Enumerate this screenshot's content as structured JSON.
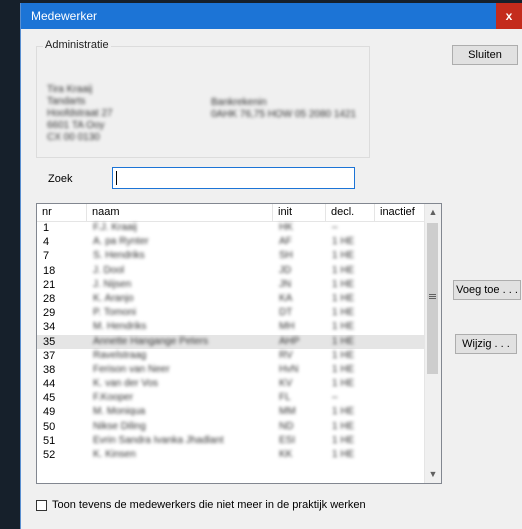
{
  "window": {
    "title": "Medewerker",
    "close_glyph": "x"
  },
  "admin": {
    "label": "Administratie",
    "left_lines": [
      "Tira Kraaij",
      "Tandarts",
      "Hoofdstraat 27",
      "6601 TA Ooy",
      "CX 00 0130"
    ],
    "right_lines": [
      "Bankrekenin",
      "0AHK 76,75 HOW 05 2080 1421"
    ]
  },
  "buttons": {
    "sluiten": "Sluiten",
    "voeg_toe": "Voeg toe . . .",
    "wijzig": "Wijzig . . ."
  },
  "search": {
    "label": "Zoek",
    "value": ""
  },
  "table": {
    "headers": {
      "nr": "nr",
      "naam": "naam",
      "init": "init",
      "decl": "decl.",
      "inactief": "inactief"
    },
    "rows": [
      {
        "nr": "1",
        "naam": "F.J. Kraaij",
        "init": "HK",
        "decl": "–",
        "selected": false
      },
      {
        "nr": "4",
        "naam": "A. pa Rynter",
        "init": "AF",
        "decl": "1 HE",
        "selected": false
      },
      {
        "nr": "7",
        "naam": "S. Hendriks",
        "init": "SH",
        "decl": "1 HE",
        "selected": false
      },
      {
        "nr": "18",
        "naam": "J. Dool",
        "init": "JD",
        "decl": "1 HE",
        "selected": false
      },
      {
        "nr": "21",
        "naam": "J. Nijsen",
        "init": "JN",
        "decl": "1 HE",
        "selected": false
      },
      {
        "nr": "28",
        "naam": "K. Aranjo",
        "init": "KA",
        "decl": "1 HE",
        "selected": false
      },
      {
        "nr": "29",
        "naam": "P. Tomoni",
        "init": "DT",
        "decl": "1 HE",
        "selected": false
      },
      {
        "nr": "34",
        "naam": "M. Hendriks",
        "init": "MH",
        "decl": "1 HE",
        "selected": false
      },
      {
        "nr": "35",
        "naam": "Annette Hangange Peters",
        "init": "AHP",
        "decl": "1 HE",
        "selected": true
      },
      {
        "nr": "37",
        "naam": "Ravelstraag",
        "init": "RV",
        "decl": "1 HE",
        "selected": false
      },
      {
        "nr": "38",
        "naam": "Ferison van Neer",
        "init": "HvN",
        "decl": "1 HE",
        "selected": false
      },
      {
        "nr": "44",
        "naam": "K. van der Vos",
        "init": "KV",
        "decl": "1 HE",
        "selected": false
      },
      {
        "nr": "45",
        "naam": "F.Kooper",
        "init": "FL",
        "decl": "–",
        "selected": false
      },
      {
        "nr": "49",
        "naam": "M. Moniqua",
        "init": "MM",
        "decl": "1 HE",
        "selected": false
      },
      {
        "nr": "50",
        "naam": "Nikse Diling",
        "init": "ND",
        "decl": "1 HE",
        "selected": false
      },
      {
        "nr": "51",
        "naam": "Evrin Sandra Ivanka Jhadlant",
        "init": "ESI",
        "decl": "1 HE",
        "selected": false
      },
      {
        "nr": "52",
        "naam": "K. Kinsen",
        "init": "KK",
        "decl": "1 HE",
        "selected": false
      }
    ]
  },
  "checkbox": {
    "label": "Toon tevens de medewerkers die niet meer in de praktijk werken",
    "checked": false
  },
  "icons": {
    "scroll_up": "up-arrow",
    "scroll_down": "down-arrow",
    "scroll_grip": "grip"
  }
}
